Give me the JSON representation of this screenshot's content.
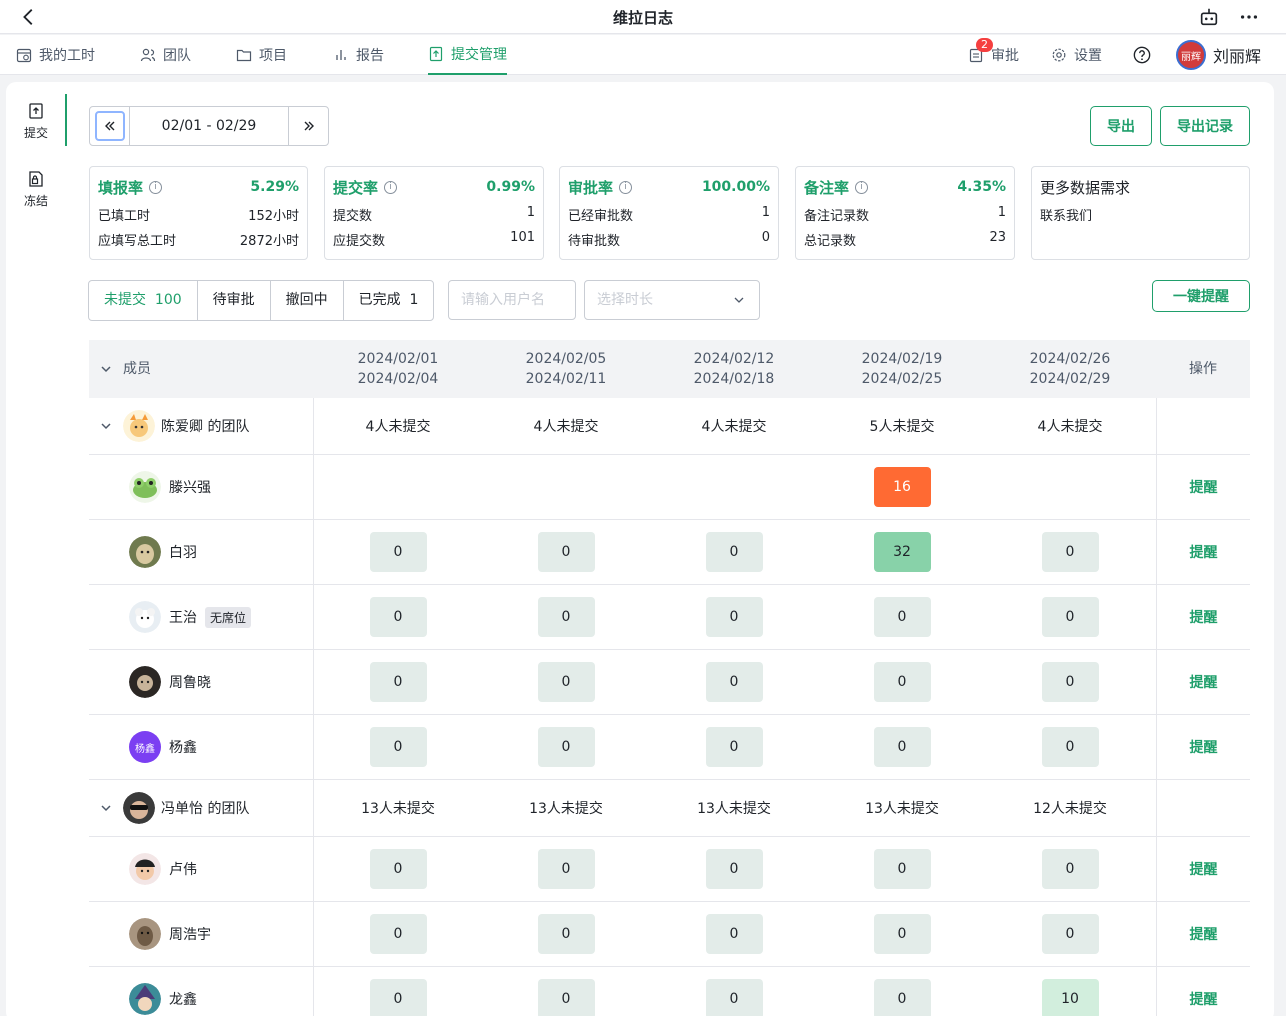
{
  "app": {
    "title": "维拉日志"
  },
  "nav": {
    "items": [
      {
        "label": "我的工时",
        "icon": "calendar-clock-icon"
      },
      {
        "label": "团队",
        "icon": "users-icon"
      },
      {
        "label": "项目",
        "icon": "folder-icon"
      },
      {
        "label": "报告",
        "icon": "bar-chart-icon"
      },
      {
        "label": "提交管理",
        "icon": "upload-doc-icon"
      }
    ],
    "approve": {
      "label": "审批",
      "badge": "2"
    },
    "settings": "设置",
    "user": {
      "name": "刘丽辉",
      "avatar_text": "丽辉"
    }
  },
  "sidebar": {
    "submit": "提交",
    "freeze": "冻结"
  },
  "date_range": "02/01 - 02/29",
  "buttons": {
    "export": "导出",
    "export_log": "导出记录",
    "remind_all": "一键提醒",
    "remind": "提醒"
  },
  "stats": {
    "fill": {
      "title": "填报率",
      "pct": "5.29%",
      "r1_label": "已填工时",
      "r1_value": "152小时",
      "r2_label": "应填写总工时",
      "r2_value": "2872小时"
    },
    "submit": {
      "title": "提交率",
      "pct": "0.99%",
      "r1_label": "提交数",
      "r1_value": "1",
      "r2_label": "应提交数",
      "r2_value": "101"
    },
    "approve": {
      "title": "审批率",
      "pct": "100.00%",
      "r1_label": "已经审批数",
      "r1_value": "1",
      "r2_label": "待审批数",
      "r2_value": "0"
    },
    "note": {
      "title": "备注率",
      "pct": "4.35%",
      "r1_label": "备注记录数",
      "r1_value": "1",
      "r2_label": "总记录数",
      "r2_value": "23"
    },
    "more": {
      "title": "更多数据需求",
      "link": "联系我们"
    }
  },
  "filters": {
    "unsubmitted": "未提交",
    "unsubmitted_count": "100",
    "pending": "待审批",
    "withdrawing": "撤回中",
    "done": "已完成",
    "done_count": "1"
  },
  "search": {
    "user_placeholder": "请输入用户名",
    "duration_placeholder": "选择时长"
  },
  "table": {
    "member_header": "成员",
    "op_header": "操作",
    "periods": [
      {
        "start": "2024/02/01",
        "end": "2024/02/04"
      },
      {
        "start": "2024/02/05",
        "end": "2024/02/11"
      },
      {
        "start": "2024/02/12",
        "end": "2024/02/18"
      },
      {
        "start": "2024/02/19",
        "end": "2024/02/25"
      },
      {
        "start": "2024/02/26",
        "end": "2024/02/29"
      }
    ],
    "team1": {
      "name": "陈爱卿 的团队",
      "summary": [
        "4人未提交",
        "4人未提交",
        "4人未提交",
        "5人未提交",
        "4人未提交"
      ]
    },
    "team2": {
      "name": "冯单怡 的团队",
      "summary": [
        "13人未提交",
        "13人未提交",
        "13人未提交",
        "13人未提交",
        "12人未提交"
      ]
    },
    "members": [
      {
        "name": "滕兴强",
        "values": [
          "",
          "",
          "",
          "16",
          ""
        ]
      },
      {
        "name": "白羽",
        "values": [
          "0",
          "0",
          "0",
          "32",
          "0"
        ]
      },
      {
        "name": "王治",
        "tag": "无席位",
        "values": [
          "0",
          "0",
          "0",
          "0",
          "0"
        ]
      },
      {
        "name": "周鲁晓",
        "values": [
          "0",
          "0",
          "0",
          "0",
          "0"
        ]
      },
      {
        "name": "杨鑫",
        "avatar_text": "杨鑫",
        "values": [
          "0",
          "0",
          "0",
          "0",
          "0"
        ]
      },
      {
        "name": "卢伟",
        "values": [
          "0",
          "0",
          "0",
          "0",
          "0"
        ]
      },
      {
        "name": "周浩宇",
        "values": [
          "0",
          "0",
          "0",
          "0",
          "0"
        ]
      },
      {
        "name": "龙鑫",
        "values": [
          "0",
          "0",
          "0",
          "0",
          "10"
        ]
      }
    ]
  },
  "colors": {
    "accent": "#1f9f6b",
    "orange": "#ff6a33",
    "green": "#88d2a9"
  }
}
